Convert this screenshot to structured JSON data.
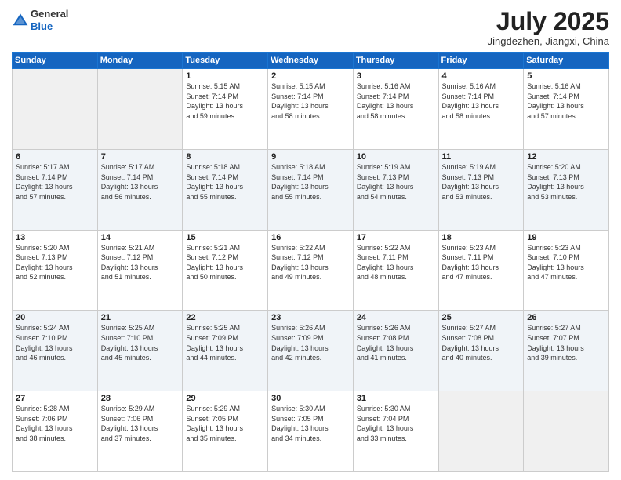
{
  "header": {
    "logo_line1": "General",
    "logo_line2": "Blue",
    "month_year": "July 2025",
    "location": "Jingdezhen, Jiangxi, China"
  },
  "weekdays": [
    "Sunday",
    "Monday",
    "Tuesday",
    "Wednesday",
    "Thursday",
    "Friday",
    "Saturday"
  ],
  "weeks": [
    [
      {
        "day": "",
        "info": ""
      },
      {
        "day": "",
        "info": ""
      },
      {
        "day": "1",
        "info": "Sunrise: 5:15 AM\nSunset: 7:14 PM\nDaylight: 13 hours\nand 59 minutes."
      },
      {
        "day": "2",
        "info": "Sunrise: 5:15 AM\nSunset: 7:14 PM\nDaylight: 13 hours\nand 58 minutes."
      },
      {
        "day": "3",
        "info": "Sunrise: 5:16 AM\nSunset: 7:14 PM\nDaylight: 13 hours\nand 58 minutes."
      },
      {
        "day": "4",
        "info": "Sunrise: 5:16 AM\nSunset: 7:14 PM\nDaylight: 13 hours\nand 58 minutes."
      },
      {
        "day": "5",
        "info": "Sunrise: 5:16 AM\nSunset: 7:14 PM\nDaylight: 13 hours\nand 57 minutes."
      }
    ],
    [
      {
        "day": "6",
        "info": "Sunrise: 5:17 AM\nSunset: 7:14 PM\nDaylight: 13 hours\nand 57 minutes."
      },
      {
        "day": "7",
        "info": "Sunrise: 5:17 AM\nSunset: 7:14 PM\nDaylight: 13 hours\nand 56 minutes."
      },
      {
        "day": "8",
        "info": "Sunrise: 5:18 AM\nSunset: 7:14 PM\nDaylight: 13 hours\nand 55 minutes."
      },
      {
        "day": "9",
        "info": "Sunrise: 5:18 AM\nSunset: 7:14 PM\nDaylight: 13 hours\nand 55 minutes."
      },
      {
        "day": "10",
        "info": "Sunrise: 5:19 AM\nSunset: 7:13 PM\nDaylight: 13 hours\nand 54 minutes."
      },
      {
        "day": "11",
        "info": "Sunrise: 5:19 AM\nSunset: 7:13 PM\nDaylight: 13 hours\nand 53 minutes."
      },
      {
        "day": "12",
        "info": "Sunrise: 5:20 AM\nSunset: 7:13 PM\nDaylight: 13 hours\nand 53 minutes."
      }
    ],
    [
      {
        "day": "13",
        "info": "Sunrise: 5:20 AM\nSunset: 7:13 PM\nDaylight: 13 hours\nand 52 minutes."
      },
      {
        "day": "14",
        "info": "Sunrise: 5:21 AM\nSunset: 7:12 PM\nDaylight: 13 hours\nand 51 minutes."
      },
      {
        "day": "15",
        "info": "Sunrise: 5:21 AM\nSunset: 7:12 PM\nDaylight: 13 hours\nand 50 minutes."
      },
      {
        "day": "16",
        "info": "Sunrise: 5:22 AM\nSunset: 7:12 PM\nDaylight: 13 hours\nand 49 minutes."
      },
      {
        "day": "17",
        "info": "Sunrise: 5:22 AM\nSunset: 7:11 PM\nDaylight: 13 hours\nand 48 minutes."
      },
      {
        "day": "18",
        "info": "Sunrise: 5:23 AM\nSunset: 7:11 PM\nDaylight: 13 hours\nand 47 minutes."
      },
      {
        "day": "19",
        "info": "Sunrise: 5:23 AM\nSunset: 7:10 PM\nDaylight: 13 hours\nand 47 minutes."
      }
    ],
    [
      {
        "day": "20",
        "info": "Sunrise: 5:24 AM\nSunset: 7:10 PM\nDaylight: 13 hours\nand 46 minutes."
      },
      {
        "day": "21",
        "info": "Sunrise: 5:25 AM\nSunset: 7:10 PM\nDaylight: 13 hours\nand 45 minutes."
      },
      {
        "day": "22",
        "info": "Sunrise: 5:25 AM\nSunset: 7:09 PM\nDaylight: 13 hours\nand 44 minutes."
      },
      {
        "day": "23",
        "info": "Sunrise: 5:26 AM\nSunset: 7:09 PM\nDaylight: 13 hours\nand 42 minutes."
      },
      {
        "day": "24",
        "info": "Sunrise: 5:26 AM\nSunset: 7:08 PM\nDaylight: 13 hours\nand 41 minutes."
      },
      {
        "day": "25",
        "info": "Sunrise: 5:27 AM\nSunset: 7:08 PM\nDaylight: 13 hours\nand 40 minutes."
      },
      {
        "day": "26",
        "info": "Sunrise: 5:27 AM\nSunset: 7:07 PM\nDaylight: 13 hours\nand 39 minutes."
      }
    ],
    [
      {
        "day": "27",
        "info": "Sunrise: 5:28 AM\nSunset: 7:06 PM\nDaylight: 13 hours\nand 38 minutes."
      },
      {
        "day": "28",
        "info": "Sunrise: 5:29 AM\nSunset: 7:06 PM\nDaylight: 13 hours\nand 37 minutes."
      },
      {
        "day": "29",
        "info": "Sunrise: 5:29 AM\nSunset: 7:05 PM\nDaylight: 13 hours\nand 35 minutes."
      },
      {
        "day": "30",
        "info": "Sunrise: 5:30 AM\nSunset: 7:05 PM\nDaylight: 13 hours\nand 34 minutes."
      },
      {
        "day": "31",
        "info": "Sunrise: 5:30 AM\nSunset: 7:04 PM\nDaylight: 13 hours\nand 33 minutes."
      },
      {
        "day": "",
        "info": ""
      },
      {
        "day": "",
        "info": ""
      }
    ]
  ]
}
